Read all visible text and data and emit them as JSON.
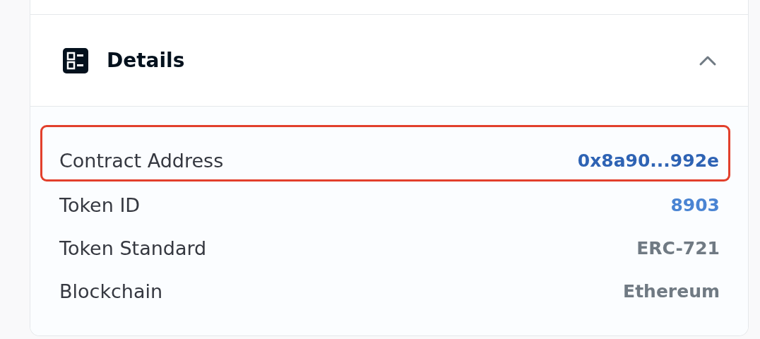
{
  "panel": {
    "title": "Details",
    "expanded": true
  },
  "rows": [
    {
      "label": "Contract Address",
      "value": "0x8a90...992e",
      "kind": "link",
      "highlighted": true
    },
    {
      "label": "Token ID",
      "value": "8903",
      "kind": "link",
      "highlighted": false
    },
    {
      "label": "Token Standard",
      "value": "ERC-721",
      "kind": "text",
      "highlighted": false
    },
    {
      "label": "Blockchain",
      "value": "Ethereum",
      "kind": "text",
      "highlighted": false
    }
  ]
}
